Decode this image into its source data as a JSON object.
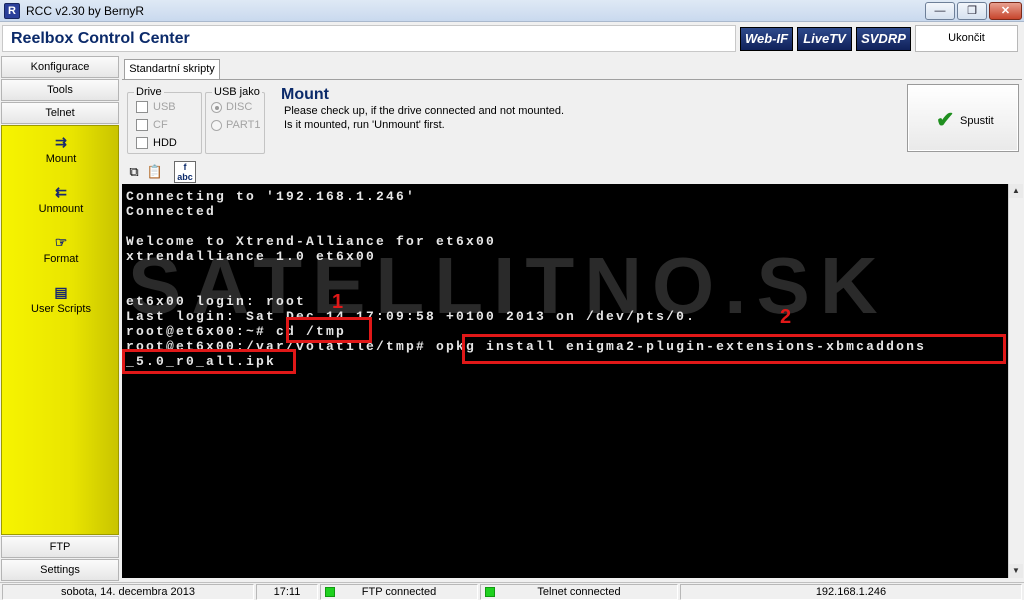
{
  "window": {
    "title": "RCC v2.30 by BernyR",
    "minimize_label": "—",
    "maximize_label": "❐",
    "close_label": "✕"
  },
  "header": {
    "app_title": "Reelbox Control Center",
    "webif": "Web-IF",
    "livetv": "LiveTV",
    "svdrp": "SVDRP",
    "exit": "Ukončit"
  },
  "nav": {
    "konfiguracia": "Konfigurace",
    "tools": "Tools",
    "telnet": "Telnet",
    "ftp": "FTP",
    "settings": "Settings",
    "tools_list": [
      {
        "label": "Mount",
        "icon": "mount-icon"
      },
      {
        "label": "Unmount",
        "icon": "unmount-icon"
      },
      {
        "label": "Format",
        "icon": "format-icon"
      },
      {
        "label": "User Scripts",
        "icon": "user-scripts-icon"
      }
    ]
  },
  "tabs": {
    "active": "Standartní skripty"
  },
  "options": {
    "drive_label": "Drive",
    "drive_options": [
      "USB",
      "CF",
      "HDD"
    ],
    "usb_label": "USB jako",
    "usb_options": [
      "DISC",
      "PART1"
    ],
    "usb_selected": "DISC"
  },
  "mount_info": {
    "title": "Mount",
    "line1": "Please check up, if the drive connected and not mounted.",
    "line2": "Is it mounted, run 'Unmount' first."
  },
  "run_button": {
    "label": "Spustit"
  },
  "terminal": {
    "watermark": "SATELLITNO.SK",
    "lines": [
      "Connecting to '192.168.1.246'",
      "Connected",
      "Welcome to Xtrend-Alliance for et6x00",
      "xtrendalliance 1.0 et6x00",
      "et6x00 login: root",
      "Last login: Sat Dec 14 17:09:58 +0100 2013 on /dev/pts/0.",
      "root@et6x00:~# cd /tmp",
      "root@et6x00:/var/volatile/tmp# opkg install enigma2-plugin-extensions-xbmcaddons",
      "_5.0_r0_all.ipk"
    ],
    "annotation_1": "1",
    "annotation_2": "2"
  },
  "status": {
    "date": "sobota, 14. decembra 2013",
    "time": "17:11",
    "ftp": "FTP connected",
    "telnet": "Telnet connected",
    "ip": "192.168.1.246",
    "led_color": "#1fd11f"
  }
}
